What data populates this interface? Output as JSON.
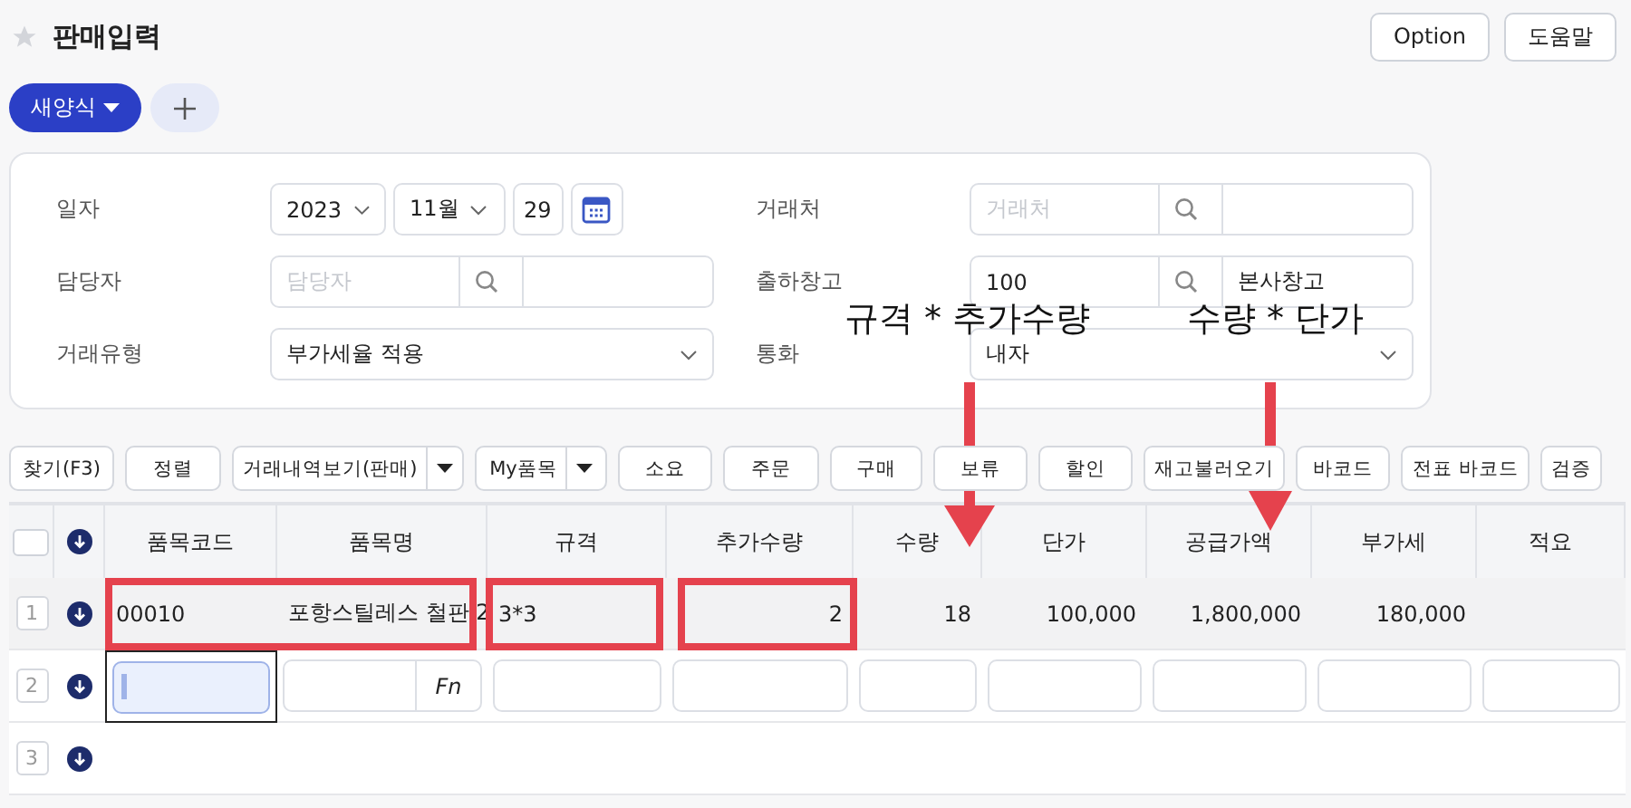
{
  "header": {
    "title": "판매입력",
    "favorite": false,
    "buttons": [
      "Option",
      "도움말"
    ]
  },
  "form_bar": {
    "new_form": "새양식"
  },
  "form": {
    "left": [
      {
        "kind": "date",
        "label": "일자",
        "year": "2023",
        "month": "11월",
        "day": "29"
      },
      {
        "kind": "lookup",
        "label": "담당자",
        "placeholder": "담당자"
      },
      {
        "kind": "select",
        "label": "거래유형",
        "value": "부가세율 적용"
      }
    ],
    "right": [
      {
        "kind": "lookup",
        "label": "거래처",
        "placeholder": "거래처"
      },
      {
        "kind": "lookup",
        "label": "출하창고",
        "code": "100",
        "name": "본사창고"
      },
      {
        "kind": "select",
        "label": "통화",
        "value": "내자"
      }
    ]
  },
  "toolbar": [
    {
      "kind": "button",
      "label": "찾기(F3)"
    },
    {
      "kind": "button",
      "label": "정렬"
    },
    {
      "kind": "split",
      "label": "거래내역보기(판매)"
    },
    {
      "kind": "split",
      "label": "My품목"
    },
    {
      "kind": "button",
      "label": "소요"
    },
    {
      "kind": "button",
      "label": "주문"
    },
    {
      "kind": "button",
      "label": "구매"
    },
    {
      "kind": "button",
      "label": "보류"
    },
    {
      "kind": "button",
      "label": "할인"
    },
    {
      "kind": "button",
      "label": "재고불러오기"
    },
    {
      "kind": "button",
      "label": "바코드"
    },
    {
      "kind": "button",
      "label": "전표 바코드"
    },
    {
      "kind": "button",
      "label": "검증"
    }
  ],
  "table": {
    "select_all": {
      "checked": false
    },
    "columns": [
      "품목코드",
      "품목명",
      "규격",
      "추가수량",
      "수량",
      "단가",
      "공급가액",
      "부가세",
      "적요"
    ],
    "rows": [
      {
        "kind": "data",
        "number": "1",
        "selected": true,
        "cells": [
          "00010",
          "포항스틸레스 철판 2",
          "3*3",
          "2",
          "18",
          "100,000",
          "1,800,000",
          "180,000"
        ]
      },
      {
        "kind": "input",
        "number": "2",
        "selected": false,
        "fn": "Fn"
      },
      {
        "kind": "empty",
        "number": "3",
        "selected": false
      }
    ]
  },
  "annotations": [
    {
      "text": "규격 * 추가수량"
    },
    {
      "text": "수량 * 단가"
    }
  ]
}
